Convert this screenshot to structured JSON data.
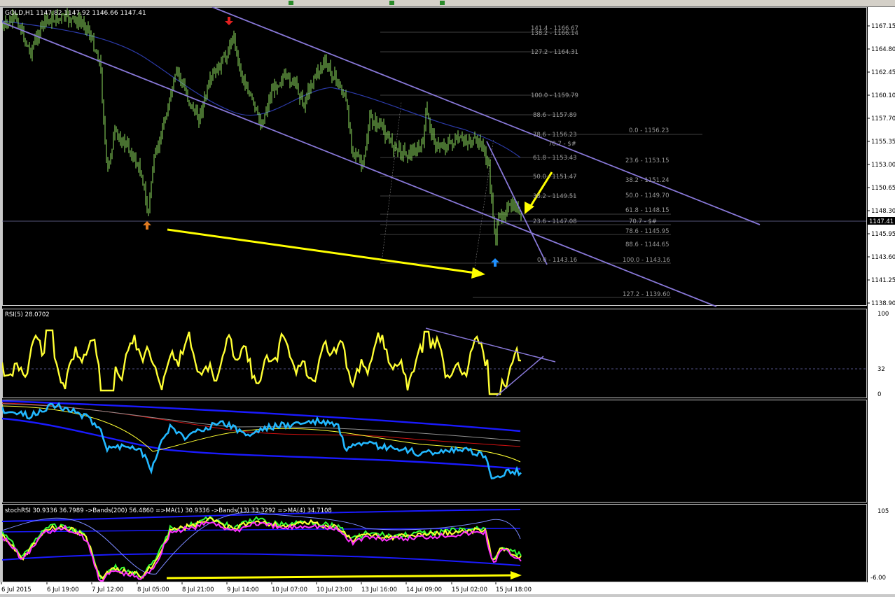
{
  "header": {
    "symbol_info": "GOLD,H1  1147.82  1147.92 1146.66 1147.41"
  },
  "price_axis": {
    "labels": [
      "1167.15",
      "1164.80",
      "1162.45",
      "1160.10",
      "1157.70",
      "1155.35",
      "1153.00",
      "1150.65",
      "1148.30",
      "1145.95",
      "1143.60",
      "1141.25",
      "1138.90"
    ],
    "current": "1147.41"
  },
  "rsi_panel": {
    "title": "RSI(5) 28.0702",
    "levels": [
      "100",
      "32",
      "0"
    ]
  },
  "stoch_panel": {
    "title": "stochRSI 30.9336 36.7989  ->Bands(200) 56.4860  =>MA(1) 30.9336  ->Bands(13) 33.3292  =>MA(4) 34.7108",
    "levels": [
      "105",
      "-6.00"
    ]
  },
  "time_axis": {
    "labels": [
      "6 Jul 2015",
      "6 Jul 19:00",
      "7 Jul 12:00",
      "8 Jul 05:00",
      "8 Jul 21:00",
      "9 Jul 14:00",
      "10 Jul 07:00",
      "10 Jul 23:00",
      "13 Jul 16:00",
      "14 Jul 09:00",
      "15 Jul 02:00",
      "15 Jul 18:00"
    ]
  },
  "fib_left": [
    {
      "text": "141.4 - 1166.67"
    },
    {
      "text": "138.2 - 1166.14"
    },
    {
      "text": "127.2 - 1164.31"
    },
    {
      "text": "100.0 - 1159.79"
    },
    {
      "text": "88.6 - 1157.89"
    },
    {
      "text": "78.6 - 1156.23"
    },
    {
      "text": "70.7 - $#"
    },
    {
      "text": "61.8 - 1153.43"
    },
    {
      "text": "50.0 - 1151.47"
    },
    {
      "text": "38.2 - 1149.51"
    },
    {
      "text": "23.6 - 1147.08"
    },
    {
      "text": "0.0 - 1143.16"
    }
  ],
  "fib_right": [
    {
      "text": "0.0 - 1156.23"
    },
    {
      "text": "23.6 - 1153.15"
    },
    {
      "text": "38.2 - 1151.24"
    },
    {
      "text": "50.0 - 1149.70"
    },
    {
      "text": "61.8 - 1148.15"
    },
    {
      "text": "70.7 - $#"
    },
    {
      "text": "78.6 - 1145.95"
    },
    {
      "text": "88.6 - 1144.65"
    },
    {
      "text": "100.0 - 1143.16"
    },
    {
      "text": "127.2 - 1139.60"
    }
  ],
  "colors": {
    "background": "#000000",
    "candles": "#8fe060",
    "channel": "#8878d8",
    "annotation": "#ffff00",
    "rsi": "#ffff33",
    "stoch_line": "#22b8ff",
    "bands": "#1a1aff",
    "ma_red": "#d01010",
    "ma_magenta": "#ff30ff",
    "arrow_up_orange": "#e07a20",
    "arrow_up_blue": "#1e90ff",
    "arrow_down_red": "#e02020"
  }
}
